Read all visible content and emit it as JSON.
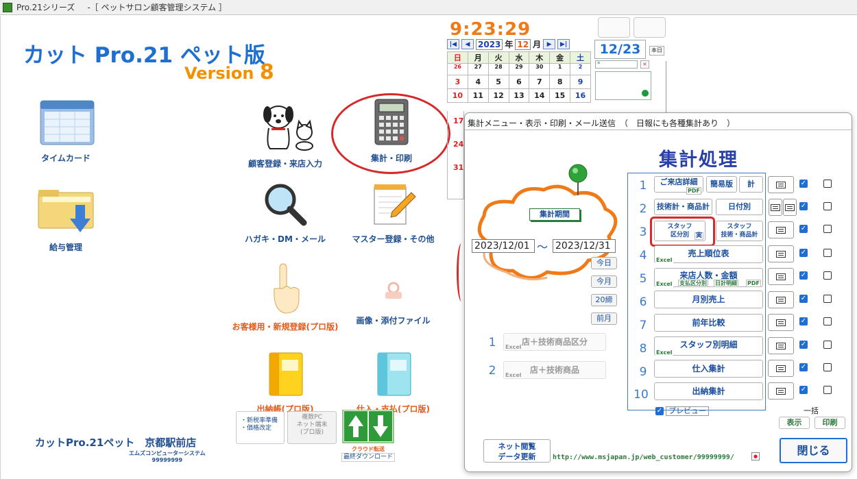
{
  "titlebar": {
    "app": "Pro.21シリーズ",
    "doc": "-［ ペットサロン顧客管理システム ］"
  },
  "logo": {
    "title": "カット Pro.21 ペット版",
    "version_label": "Version",
    "version_num": "8"
  },
  "menu": {
    "timecard": "タイムカード",
    "payroll": "給与管理",
    "customer": "顧客登録・来店入力",
    "summary": "集計・印刷",
    "postcard": "ハガキ・DM・メール",
    "master": "マスター登録・その他",
    "guest": "お客様用・新規登録(プロ版)",
    "images": "画像・添付ファイル",
    "ledger": "出納帳(プロ版)",
    "purchase": "仕入・支払(プロ版)"
  },
  "small": {
    "tax1": "・新税率準備",
    "tax2": "・価格改定",
    "multi1": "複数PC",
    "multi2": "ネット端末",
    "multi3": "(プロ版)",
    "cloud": "クラウド転送",
    "lastdl": "最終ダウンロード"
  },
  "shop": {
    "name": "カットPro.21ペット　京都駅前店",
    "company": "エムズコンピューターシステム",
    "code": "99999999"
  },
  "clock": "9:23:29",
  "calendar": {
    "year": "2023",
    "year_suffix": "年",
    "month": "12",
    "month_suffix": "月",
    "weekdays": [
      "日",
      "月",
      "火",
      "水",
      "木",
      "金",
      "土"
    ],
    "row0": [
      "26",
      "27",
      "28",
      "29",
      "30",
      "1",
      "2"
    ],
    "row1": [
      "3",
      "4",
      "5",
      "6",
      "7",
      "8",
      "9"
    ],
    "row2": [
      "10",
      "11",
      "12",
      "13",
      "14",
      "15",
      "16"
    ],
    "sidenums": [
      "17",
      "24",
      "31"
    ],
    "today": "12/23",
    "today_btn": "本日",
    "memo_star": "*",
    "memo_x": "×"
  },
  "dialog": {
    "title": "集計メニュー・表示・印刷・メール送信　（　日報にも各種集計あり　）",
    "heading": "集計処理",
    "period_label": "集計期間",
    "date_from": "2023/12/01",
    "tilde": "〜",
    "date_to": "2023/12/31",
    "quick": [
      "今日",
      "今月",
      "20締",
      "前月"
    ],
    "left_items": [
      {
        "num": "1",
        "label": "店＋技術商品区分",
        "excel": "Excel"
      },
      {
        "num": "2",
        "label": "店＋技術商品",
        "excel": "Excel"
      }
    ],
    "rows": [
      {
        "num": "1"
      },
      {
        "num": "2"
      },
      {
        "num": "3"
      },
      {
        "num": "4"
      },
      {
        "num": "5"
      },
      {
        "num": "6"
      },
      {
        "num": "7"
      },
      {
        "num": "8"
      },
      {
        "num": "9"
      },
      {
        "num": "10"
      }
    ],
    "r1": {
      "a": "ご来店詳細",
      "pdf": "PDF",
      "b": "簡易版",
      "c": "計"
    },
    "r2": {
      "a": "技術計・商品計",
      "b": "日付別"
    },
    "r3": {
      "a1": "スタッフ",
      "a2": "区分別",
      "jitsu": "実",
      "b1": "スタッフ",
      "b2": "技術・商品計"
    },
    "r4": {
      "a": "売上順位表",
      "excel": "Excel"
    },
    "r5": {
      "a": "来店人数・金額",
      "excel": "Excel",
      "t1": "支払区分別",
      "t2": "日計明細",
      "pdf": "PDF"
    },
    "r6": {
      "a": "月別売上"
    },
    "r7": {
      "a": "前年比較"
    },
    "r8": {
      "a": "スタッフ別明細",
      "excel": "Excel"
    },
    "r9": {
      "a": "仕入集計"
    },
    "r10": {
      "a": "出納集計"
    },
    "preview": "プレビュー",
    "ikkatsu": "一括",
    "show": "表示",
    "print": "印刷",
    "net1": "ネット閲覧",
    "net2": "データ更新",
    "url": "http://www.msjapan.jp/web_customer/99999999/",
    "close": "閉じる"
  },
  "colors": {
    "brand": "#1f6fd1",
    "accent": "#f29000",
    "clock": "#f07a18",
    "heading": "#2940a8",
    "ring": "#d62a2a"
  }
}
